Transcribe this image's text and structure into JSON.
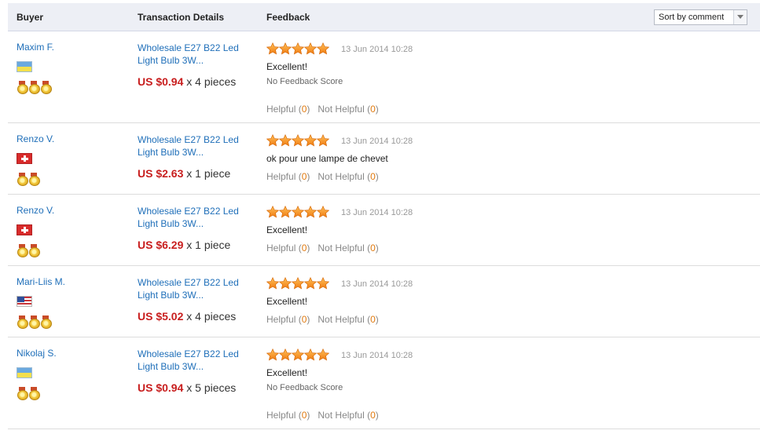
{
  "header": {
    "buyer": "Buyer",
    "transaction": "Transaction Details",
    "feedback": "Feedback",
    "sort_label": "Sort by comment"
  },
  "rows": [
    {
      "buyer": "Maxim F.",
      "flag": "ua",
      "medals": 3,
      "product": "Wholesale E27 B22 Led Light Bulb 3W...",
      "price": "US $0.94",
      "qty": "x 4 pieces",
      "stars": 5,
      "date": "13 Jun 2014 10:28",
      "comment": "Excellent!",
      "no_score": "No Feedback Score",
      "helpful_label": "Helpful",
      "helpful_count": "0",
      "not_helpful_label": "Not Helpful",
      "not_helpful_count": "0"
    },
    {
      "buyer": "Renzo V.",
      "flag": "ch",
      "medals": 2,
      "product": "Wholesale E27 B22 Led Light Bulb 3W...",
      "price": "US $2.63",
      "qty": "x 1 piece",
      "stars": 5,
      "date": "13 Jun 2014 10:28",
      "comment": "ok pour une lampe de chevet",
      "no_score": "",
      "helpful_label": "Helpful",
      "helpful_count": "0",
      "not_helpful_label": "Not Helpful",
      "not_helpful_count": "0"
    },
    {
      "buyer": "Renzo V.",
      "flag": "ch",
      "medals": 2,
      "product": "Wholesale E27 B22 Led Light Bulb 3W...",
      "price": "US $6.29",
      "qty": "x 1 piece",
      "stars": 5,
      "date": "13 Jun 2014 10:28",
      "comment": "Excellent!",
      "no_score": "",
      "helpful_label": "Helpful",
      "helpful_count": "0",
      "not_helpful_label": "Not Helpful",
      "not_helpful_count": "0"
    },
    {
      "buyer": "Mari-Liis M.",
      "flag": "us",
      "medals": 3,
      "product": "Wholesale E27 B22 Led Light Bulb 3W...",
      "price": "US $5.02",
      "qty": "x 4 pieces",
      "stars": 5,
      "date": "13 Jun 2014 10:28",
      "comment": "Excellent!",
      "no_score": "",
      "helpful_label": "Helpful",
      "helpful_count": "0",
      "not_helpful_label": "Not Helpful",
      "not_helpful_count": "0"
    },
    {
      "buyer": "Nikolaj S.",
      "flag": "ua",
      "medals": 2,
      "product": "Wholesale E27 B22 Led Light Bulb 3W...",
      "price": "US $0.94",
      "qty": "x 5 pieces",
      "stars": 5,
      "date": "13 Jun 2014 10:28",
      "comment": "Excellent!",
      "no_score": "No Feedback Score",
      "helpful_label": "Helpful",
      "helpful_count": "0",
      "not_helpful_label": "Not Helpful",
      "not_helpful_count": "0"
    }
  ]
}
